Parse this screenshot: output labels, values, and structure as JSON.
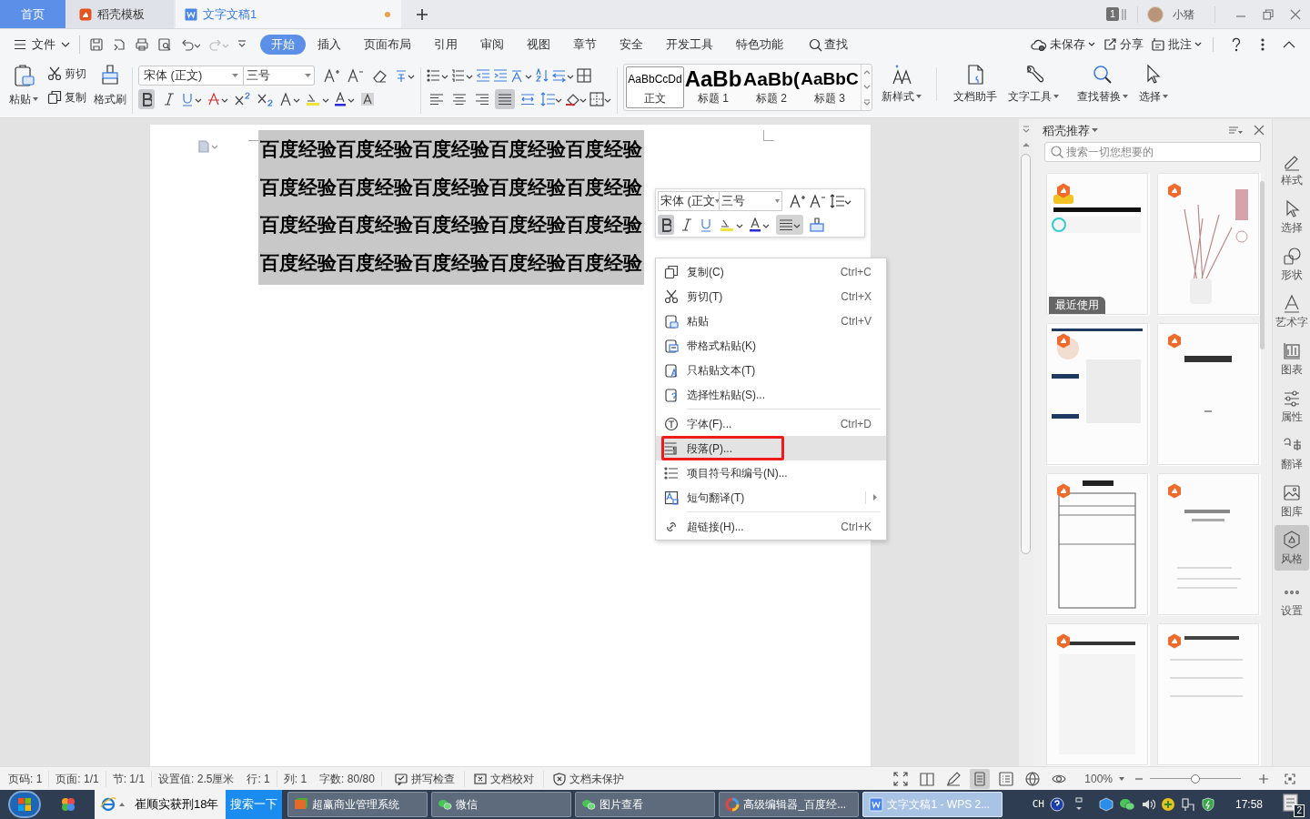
{
  "tabs": [
    {
      "label": "首页",
      "kind": "home",
      "selected": false
    },
    {
      "label": "稻壳模板",
      "kind": "docer",
      "selected": false
    },
    {
      "label": "文字文稿1",
      "kind": "doc",
      "selected": true,
      "unsaved": true
    }
  ],
  "title_bar": {
    "badge": "1",
    "user": "小猪"
  },
  "menu": {
    "file": "文件",
    "tabs": [
      {
        "label": "开始",
        "selected": true
      },
      {
        "label": "插入",
        "selected": false
      },
      {
        "label": "页面布局",
        "selected": false
      },
      {
        "label": "引用",
        "selected": false
      },
      {
        "label": "审阅",
        "selected": false
      },
      {
        "label": "视图",
        "selected": false
      },
      {
        "label": "章节",
        "selected": false
      },
      {
        "label": "安全",
        "selected": false
      },
      {
        "label": "开发工具",
        "selected": false
      },
      {
        "label": "特色功能",
        "selected": false
      }
    ],
    "find": "查找",
    "actions": [
      "未保存",
      "分享",
      "批注"
    ]
  },
  "ribbon": {
    "paste": "粘贴",
    "cut": "剪切",
    "copy": "复制",
    "format_painter": "格式刷",
    "font_name": "宋体 (正文)",
    "font_size": "三号",
    "bold": true,
    "alignment": [
      {
        "selected": false
      },
      {
        "selected": false
      },
      {
        "selected": false
      },
      {
        "selected": true
      },
      {
        "selected": false
      }
    ],
    "styles": [
      {
        "preview": "AaBbCcDd",
        "label": "正文",
        "kind": "body",
        "selected": true
      },
      {
        "preview": "AaBb",
        "label": "标题 1",
        "kind": "h1",
        "selected": false
      },
      {
        "preview": "AaBb(",
        "label": "标题 2",
        "kind": "h2",
        "selected": false
      },
      {
        "preview": "AaBbC",
        "label": "标题 3",
        "kind": "h3",
        "selected": false
      }
    ],
    "tools": [
      "新样式",
      "文档助手",
      "文字工具",
      "查找替换",
      "选择"
    ]
  },
  "document": {
    "selected": true,
    "lines": [
      "百度经验百度经验百度经验百度经验百度经验",
      "百度经验百度经验百度经验百度经验百度经验",
      "百度经验百度经验百度经验百度经验百度经验",
      "百度经验百度经验百度经验百度经验百度经验"
    ]
  },
  "mini_toolbar": {
    "font_name": "宋体 (正文",
    "font_size": "三号",
    "bold": true
  },
  "context_menu": [
    {
      "label": "复制(C)",
      "shortcut": "Ctrl+C",
      "highlighted": false
    },
    {
      "label": "剪切(T)",
      "shortcut": "Ctrl+X",
      "highlighted": false
    },
    {
      "label": "粘贴",
      "shortcut": "Ctrl+V",
      "highlighted": false
    },
    {
      "label": "带格式粘贴(K)",
      "highlighted": false
    },
    {
      "label": "只粘贴文本(T)",
      "highlighted": false
    },
    {
      "label": "选择性粘贴(S)...",
      "highlighted": false
    },
    {
      "label": "字体(F)...",
      "shortcut": "Ctrl+D",
      "highlighted": false,
      "separator_before": true
    },
    {
      "label": "段落(P)...",
      "highlighted": true,
      "annotated": true
    },
    {
      "label": "项目符号和编号(N)...",
      "highlighted": false
    },
    {
      "label": "短句翻译(T)",
      "highlighted": false,
      "submenu": true
    },
    {
      "label": "超链接(H)...",
      "shortcut": "Ctrl+K",
      "highlighted": false,
      "separator_before": true
    }
  ],
  "panel": {
    "title": "稻壳推荐",
    "search_placeholder": "搜索一切您想要的",
    "cards": [
      {
        "kind": "picture",
        "badge": "最近使用"
      },
      {
        "kind": "picture"
      },
      {
        "kind": "picture"
      },
      {
        "kind": "picture"
      },
      {
        "kind": "picture"
      },
      {
        "kind": "picture"
      },
      {
        "kind": "picture"
      },
      {
        "kind": "picture"
      }
    ]
  },
  "side_tools": [
    {
      "label": "样式",
      "selected": false
    },
    {
      "label": "选择",
      "selected": false
    },
    {
      "label": "形状",
      "selected": false
    },
    {
      "label": "艺术字",
      "selected": false
    },
    {
      "label": "图表",
      "selected": false
    },
    {
      "label": "属性",
      "selected": false
    },
    {
      "label": "翻译",
      "selected": false
    },
    {
      "label": "图库",
      "selected": false
    },
    {
      "label": "风格",
      "selected": true
    },
    {
      "label": "设置",
      "selected": false
    }
  ],
  "status_bar": {
    "fields": [
      "页码: 1",
      "页面: 1/1",
      "节: 1/1",
      "设置值: 2.5厘米",
      "行: 1",
      "列: 1",
      "字数: 80/80"
    ],
    "checks": [
      "拼写检查",
      "文档校对",
      "文档未保护"
    ],
    "views": [
      {
        "selected": false
      },
      {
        "selected": false
      },
      {
        "selected": false
      },
      {
        "selected": true
      },
      {
        "selected": false
      },
      {
        "selected": false
      },
      {
        "selected": false
      }
    ],
    "zoom": "100%",
    "zoom_slider": {
      "level": 0.5
    }
  },
  "taskbar": {
    "pinned_label": "崔顺实获刑18年",
    "search_button": "搜索一下",
    "windows": [
      {
        "label": "超赢商业管理系统",
        "selected": false
      },
      {
        "label": "微信",
        "selected": false
      },
      {
        "label": "图片查看",
        "selected": false
      },
      {
        "label": "高级编辑器_百度经...",
        "selected": false
      },
      {
        "label": "文字文稿1 - WPS 2...",
        "selected": true
      }
    ],
    "input_method": "CH",
    "clock": "17:58",
    "notification_count": "2"
  }
}
